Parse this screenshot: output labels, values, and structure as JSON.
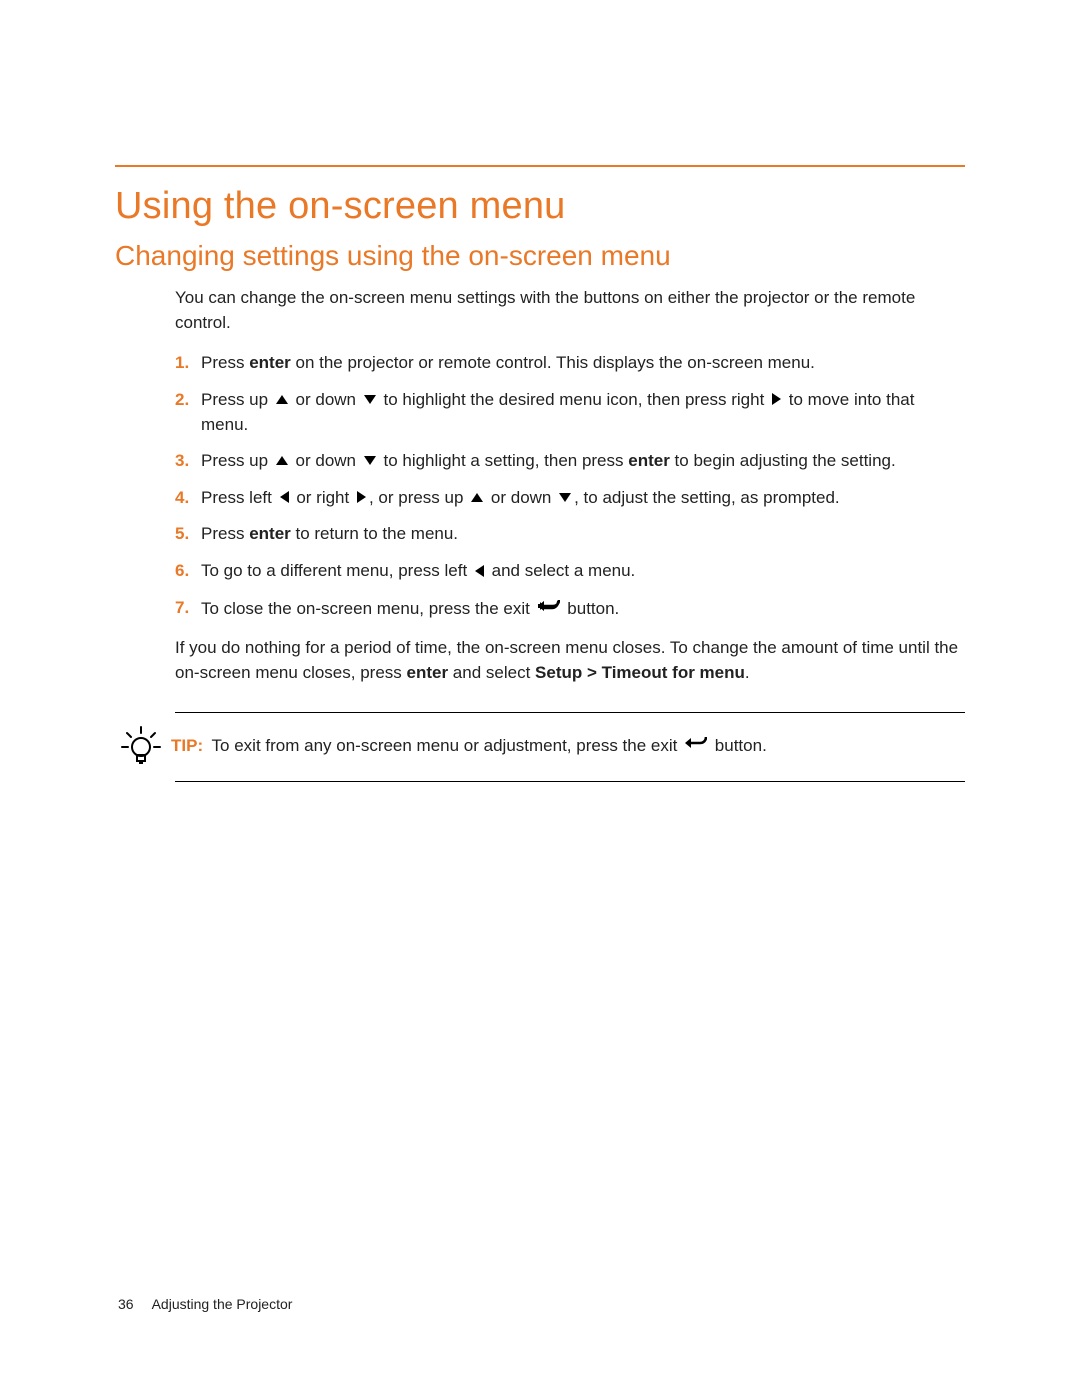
{
  "heading": "Using the on-screen menu",
  "subheading": "Changing settings using the on-screen menu",
  "intro": "You can change the on-screen menu settings with the buttons on either the projector or the remote control.",
  "steps": [
    {
      "n": "1.",
      "pre": "Press ",
      "b1": "enter",
      "post": " on the projector or remote control. This displays the on-screen menu."
    },
    {
      "n": "2.",
      "pre": "Press up ",
      "mid1": " or down ",
      "mid2": " to highlight the desired menu icon, then press right ",
      "post": " to move into that menu."
    },
    {
      "n": "3.",
      "pre": "Press up ",
      "mid1": " or down ",
      "mid2": " to highlight a setting, then press ",
      "b1": "enter",
      "post": " to begin adjusting the setting."
    },
    {
      "n": "4.",
      "pre": "Press left ",
      "mid1": " or right ",
      "mid2": ", or press up ",
      "mid3": " or down ",
      "post": ", to adjust the setting, as prompted."
    },
    {
      "n": "5.",
      "pre": "Press ",
      "b1": "enter",
      "post": " to return to the menu."
    },
    {
      "n": "6.",
      "pre": "To go to a different menu, press left ",
      "post": " and select a menu."
    },
    {
      "n": "7.",
      "pre": "To close the on-screen menu, press the exit ",
      "post": " button."
    }
  ],
  "closing_pre": "If you do nothing for a period of time, the on-screen menu closes. To change the amount of time until the on-screen menu closes, press ",
  "closing_b1": "enter",
  "closing_mid": " and select ",
  "closing_b2": "Setup > Timeout for menu",
  "closing_post": ".",
  "tip_label": "TIP:",
  "tip_pre": "To exit from any on-screen menu or adjustment, press the exit ",
  "tip_post": " button.",
  "footer_page": "36",
  "footer_title": "Adjusting the Projector"
}
